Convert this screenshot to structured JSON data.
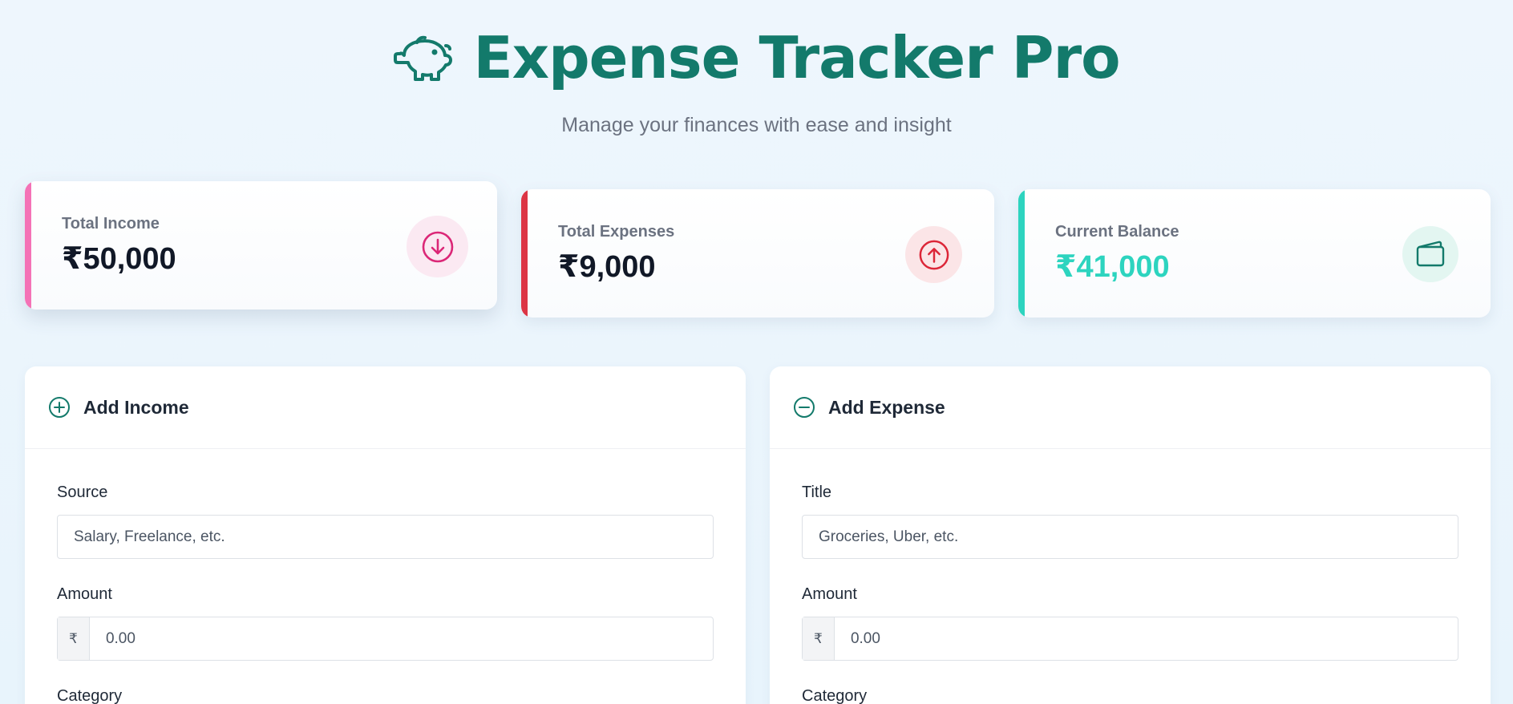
{
  "header": {
    "title": "Expense Tracker Pro",
    "subtitle": "Manage your finances with ease and insight",
    "logo_icon": "piggy-bank-icon"
  },
  "colors": {
    "brand": "#137a6b",
    "income": "#f472b6",
    "expense": "#dc3545",
    "balance": "#2dd4bf"
  },
  "summary": {
    "income": {
      "label": "Total Income",
      "value": "₹50,000",
      "icon": "arrow-down-circle-icon"
    },
    "expenses": {
      "label": "Total Expenses",
      "value": "₹9,000",
      "icon": "arrow-up-circle-icon"
    },
    "balance": {
      "label": "Current Balance",
      "value": "₹41,000",
      "icon": "wallet-icon"
    }
  },
  "income_form": {
    "title": "Add Income",
    "icon": "plus-circle-icon",
    "source_label": "Source",
    "source_placeholder": "Salary, Freelance, etc.",
    "amount_label": "Amount",
    "currency_symbol": "₹",
    "amount_placeholder": "0.00",
    "category_label": "Category"
  },
  "expense_form": {
    "title": "Add Expense",
    "icon": "minus-circle-icon",
    "title_label": "Title",
    "title_placeholder": "Groceries, Uber, etc.",
    "amount_label": "Amount",
    "currency_symbol": "₹",
    "amount_placeholder": "0.00",
    "category_label": "Category"
  }
}
